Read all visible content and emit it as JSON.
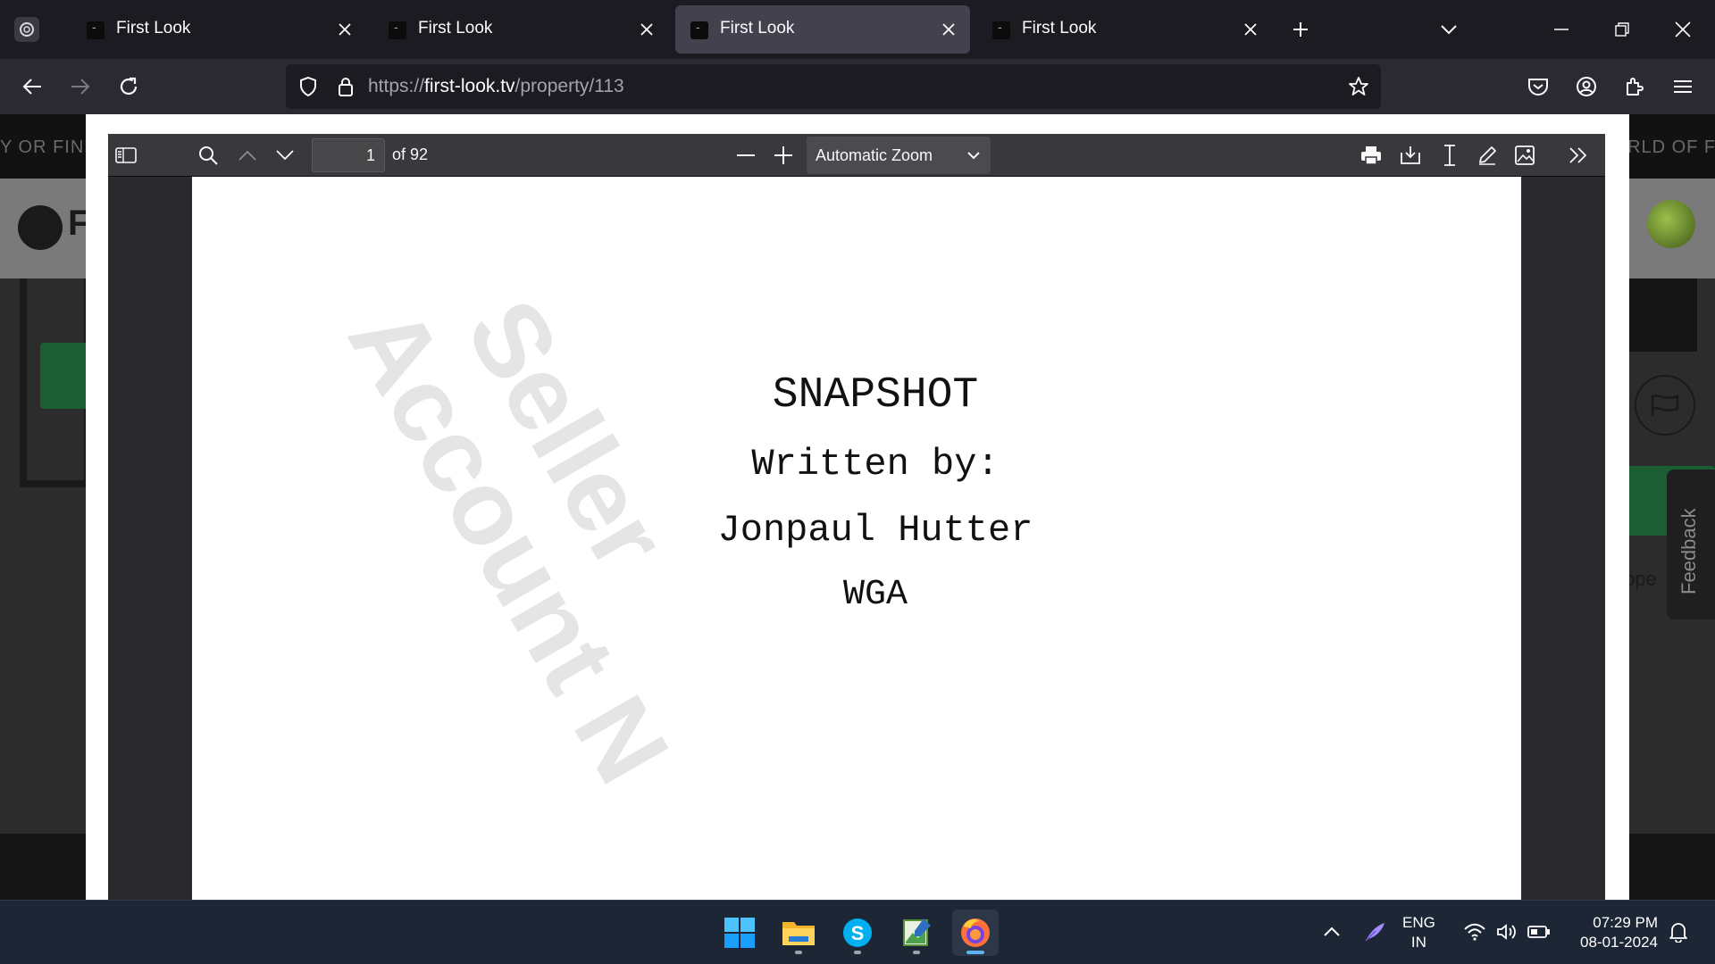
{
  "browser": {
    "tabs": [
      {
        "title": "First Look",
        "active": false
      },
      {
        "title": "First Look",
        "active": false
      },
      {
        "title": "First Look",
        "active": true
      },
      {
        "title": "First Look",
        "active": false
      }
    ],
    "url": {
      "scheme": "https://",
      "host": "first-look.tv",
      "path": "/property/113"
    }
  },
  "background_site": {
    "ticker_left": "Y OR FIND",
    "ticker_right": "RLD OF FI",
    "logo_text": "F",
    "side_text": "ope",
    "feedback_label": "Feedback"
  },
  "pdf_viewer": {
    "page_number": "1",
    "page_count": "of 92",
    "zoom": "Automatic Zoom"
  },
  "document": {
    "title": "SNAPSHOT",
    "written_by": "Written by:",
    "author": "Jonpaul Hutter",
    "guild": "WGA",
    "watermark_line1": "Seller",
    "watermark_line2": "Account N"
  },
  "taskbar": {
    "language": "ENG",
    "region": "IN",
    "time": "07:29 PM",
    "date": "08-01-2024"
  },
  "colors": {
    "browser_bg": "#1c1b22",
    "toolbar": "#2b2a33",
    "active_tab": "#42414d",
    "pdf_toolbar": "#38383d",
    "taskbar": "#1c2635",
    "accent": "#5fb2f2"
  }
}
